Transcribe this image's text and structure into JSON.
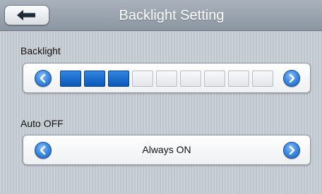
{
  "header": {
    "title": "Backlight Setting",
    "back_icon": "back-arrow-icon"
  },
  "backlight": {
    "label": "Backlight",
    "level": 3,
    "max_level": 9
  },
  "auto_off": {
    "label": "Auto OFF",
    "value": "Always ON"
  },
  "colors": {
    "accent": "#1d6fd6",
    "segment_on": "#0b56b8",
    "header": "#96a0ab"
  }
}
